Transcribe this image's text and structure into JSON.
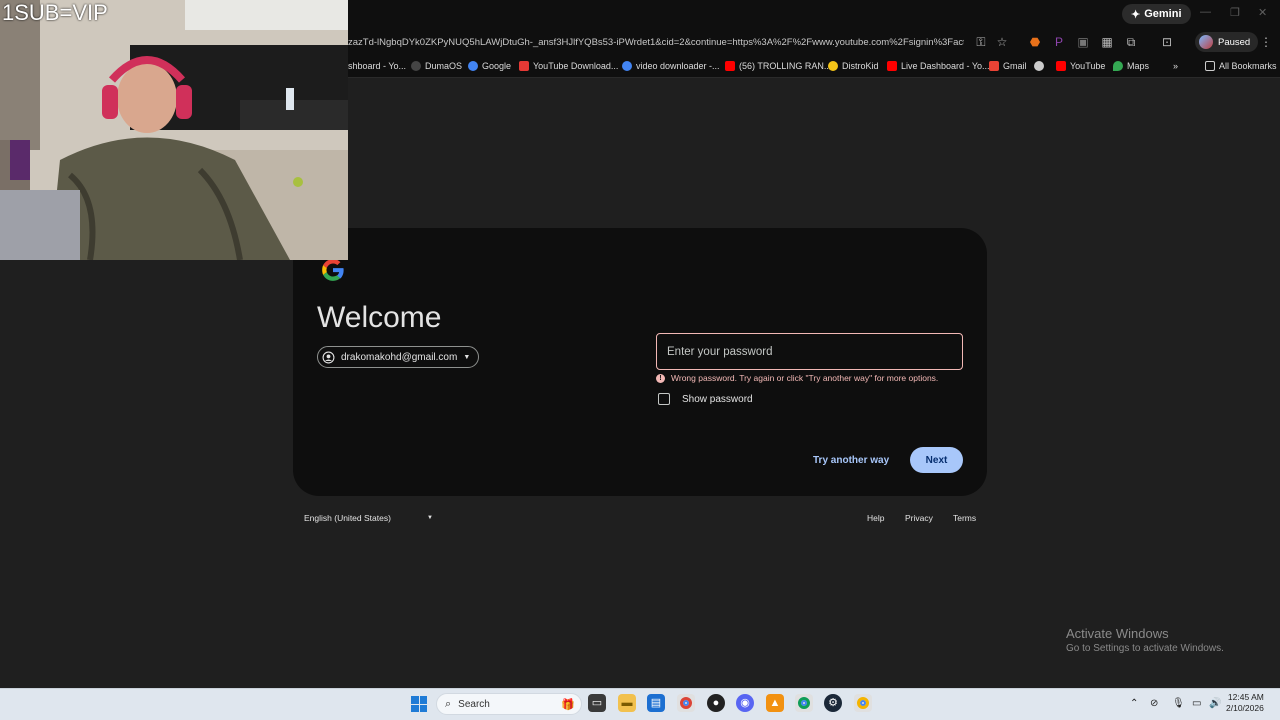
{
  "overlay": {
    "text": "1SUB=VIP"
  },
  "browser": {
    "gemini_label": "Gemini",
    "url": "zazTd-lNgbqDYk0ZKPyNUQ5hLAWjDtuGh-_ansf3HJlfYQBs53-iPWrdet1&cid=2&continue=https%3A%2F%2Fwww.youtube.com%2Fsignin%3Faction_...",
    "profile_label": "Paused",
    "bookmarks": [
      {
        "label": "shboard - Yo...",
        "color": "#d93025"
      },
      {
        "label": "DumaOS",
        "color": "#444444"
      },
      {
        "label": "Google",
        "color": "#4285f4"
      },
      {
        "label": "YouTube Download...",
        "color": "#e53935"
      },
      {
        "label": "video downloader -...",
        "color": "#4285f4"
      },
      {
        "label": "(56) TROLLING RAN...",
        "color": "#ff0000"
      },
      {
        "label": "DistroKid",
        "color": "#f5c518"
      },
      {
        "label": "Live Dashboard - Yo...",
        "color": "#ff0000"
      },
      {
        "label": "Gmail",
        "color": "#ea4335"
      },
      {
        "label": "",
        "color": "#cccccc"
      },
      {
        "label": "YouTube",
        "color": "#ff0000"
      },
      {
        "label": "Maps",
        "color": "#34a853"
      }
    ],
    "all_bookmarks_label": "All Bookmarks"
  },
  "signin": {
    "heading": "Welcome",
    "account_email": "drakomakohd@gmail.com",
    "password_placeholder": "Enter your password",
    "error_text": "Wrong password. Try again or click \"Try another way\" for more options.",
    "show_password_label": "Show password",
    "try_another_label": "Try another way",
    "next_label": "Next"
  },
  "footer": {
    "language": "English (United States)",
    "help": "Help",
    "privacy": "Privacy",
    "terms": "Terms"
  },
  "watermark": {
    "line1": "Activate Windows",
    "line2": "Go to Settings to activate Windows."
  },
  "taskbar": {
    "search_placeholder": "Search",
    "time": "12:45 AM",
    "date": "2/10/2026"
  }
}
